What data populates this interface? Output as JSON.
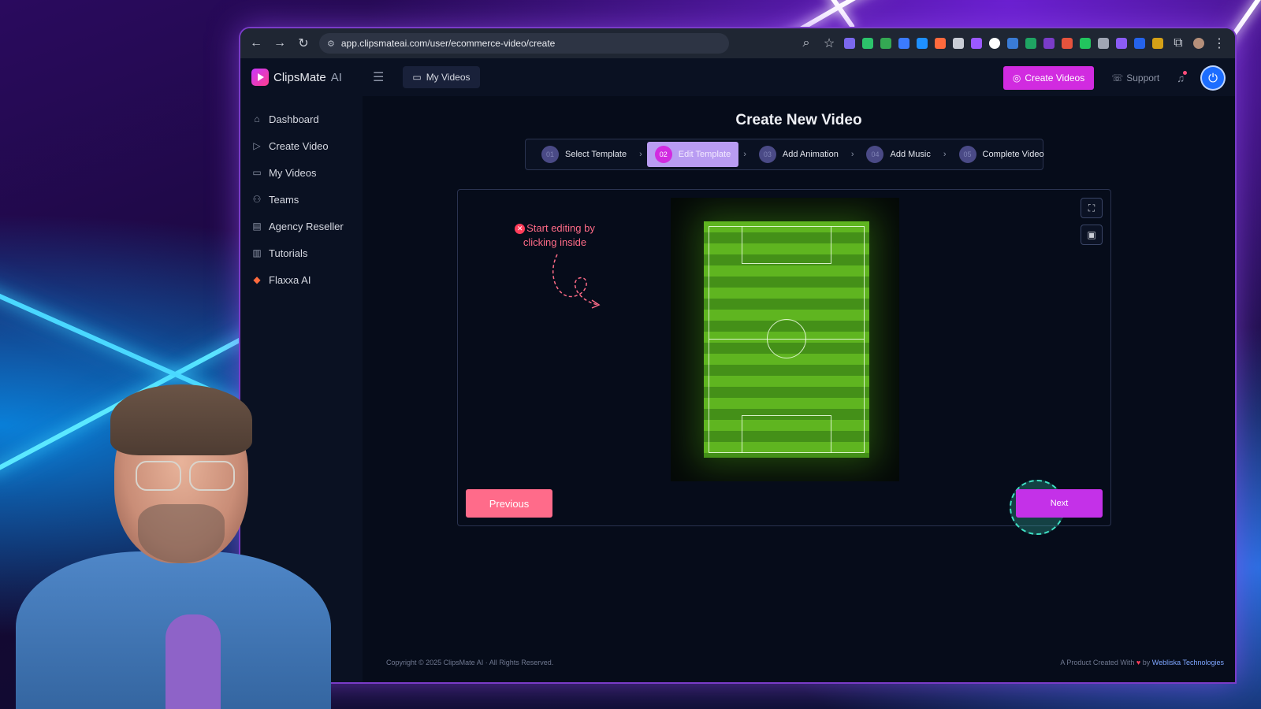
{
  "browser": {
    "url": "app.clipsmateai.com/user/ecommerce-video/create"
  },
  "app": {
    "brand": "ClipsMate",
    "brand_suffix": "AI",
    "top_tab": "My Videos",
    "create_button": "Create Videos",
    "support_link": "Support"
  },
  "sidebar": {
    "items": [
      {
        "label": "Dashboard",
        "icon": "home-icon"
      },
      {
        "label": "Create Video",
        "icon": "play-circle-icon"
      },
      {
        "label": "My Videos",
        "icon": "video-icon"
      },
      {
        "label": "Teams",
        "icon": "users-icon"
      },
      {
        "label": "Agency Reseller",
        "icon": "briefcase-icon"
      },
      {
        "label": "Tutorials",
        "icon": "book-icon"
      },
      {
        "label": "Flaxxa AI",
        "icon": "ai-icon"
      }
    ]
  },
  "main": {
    "title": "Create New Video",
    "steps": [
      {
        "num": "01",
        "label": "Select Template"
      },
      {
        "num": "02",
        "label": "Edit Template"
      },
      {
        "num": "03",
        "label": "Add Animation"
      },
      {
        "num": "04",
        "label": "Add Music"
      },
      {
        "num": "05",
        "label": "Complete Video"
      }
    ],
    "active_step": 2,
    "hint_line1": "Start editing by",
    "hint_line2": "clicking inside",
    "previous_button": "Previous",
    "next_button": "Next"
  },
  "footer": {
    "copyright": "Copyright © 2025 ClipsMate AI · All Rights Reserved.",
    "credit_prefix": "A Product Created With",
    "credit_by": "by",
    "credit_company": "Webliska Technologies"
  },
  "colors": {
    "accent": "#d12be0",
    "previous": "#ff6b8a",
    "active_step_bg": "#b99cf2"
  }
}
